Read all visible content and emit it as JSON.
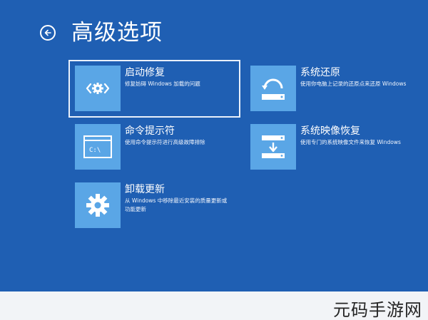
{
  "page": {
    "title": "高级选项"
  },
  "options": [
    {
      "title": "启动修复",
      "desc": "修复妨碍 Windows 加载的问题",
      "icon": "startup-repair-gear-icon"
    },
    {
      "title": "系统还原",
      "desc": "使用你电脑上记录的还原点来还原 Windows",
      "icon": "system-restore-icon"
    },
    {
      "title": "命令提示符",
      "desc": "使用命令提示符进行高级故障排除",
      "icon": "command-prompt-icon",
      "icon_text": "C:\\"
    },
    {
      "title": "系统映像恢复",
      "desc": "使用专门的系统映像文件来恢复 Windows",
      "icon": "system-image-recovery-icon"
    },
    {
      "title": "卸载更新",
      "desc": "从 Windows 中移除最近安装的质量更新或功能更新",
      "icon": "gear-icon"
    }
  ],
  "watermark": "元码手游网",
  "colors": {
    "background": "#1f5fb3",
    "tile": "#5aa6e6",
    "text": "#ffffff",
    "selection_outline": "#e9f0fb"
  }
}
